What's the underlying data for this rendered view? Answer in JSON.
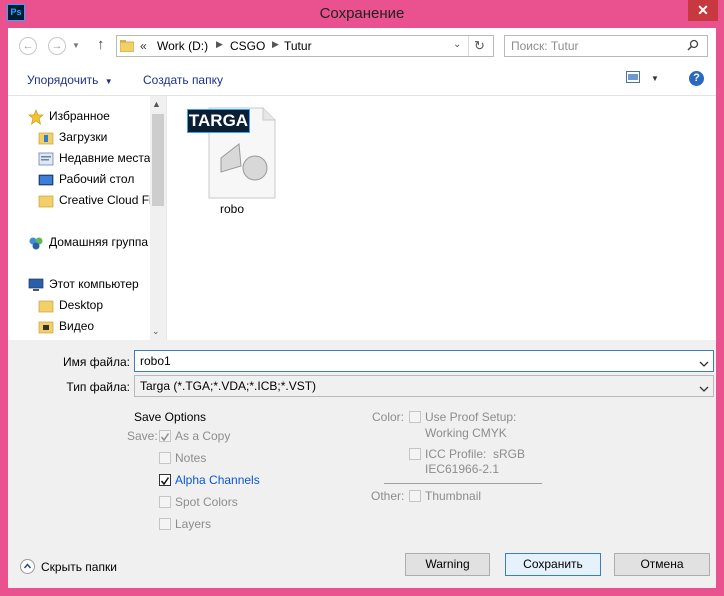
{
  "window": {
    "title": "Сохранение",
    "app_badge": "Ps"
  },
  "nav": {
    "path": [
      "«",
      "Work (D:)",
      "CSGO",
      "Tutur"
    ],
    "search_placeholder": "Поиск: Tutur"
  },
  "toolbar": {
    "organize_label": "Упорядочить",
    "new_folder_label": "Создать папку",
    "help": "?"
  },
  "sidebar": {
    "favorites": {
      "label": "Избранное",
      "items": [
        "Загрузки",
        "Недавние места",
        "Рабочий стол",
        "Creative Cloud Fi"
      ]
    },
    "homegroup": {
      "label": "Домашняя группа"
    },
    "computer": {
      "label": "Этот компьютер",
      "items": [
        "Desktop",
        "Видео"
      ]
    }
  },
  "file": {
    "name": "robo",
    "badge": "TARGA"
  },
  "form": {
    "filename_label": "Имя файла:",
    "filename_value": "robo1",
    "filetype_label": "Тип файла:",
    "filetype_value": "Targa (*.TGA;*.VDA;*.ICB;*.VST)"
  },
  "save_options": {
    "heading": "Save Options",
    "save_label": "Save:",
    "as_copy": {
      "label": "As a Copy",
      "checked": true,
      "enabled": false
    },
    "notes": {
      "label": "Notes",
      "checked": false,
      "enabled": false
    },
    "alpha": {
      "label": "Alpha Channels",
      "checked": true,
      "enabled": true
    },
    "spot": {
      "label": "Spot Colors",
      "checked": false,
      "enabled": false
    },
    "layers": {
      "label": "Layers",
      "checked": false,
      "enabled": false
    },
    "color_label": "Color:",
    "proof": {
      "line1": "Use Proof Setup:",
      "line2": "Working CMYK"
    },
    "icc": {
      "line1": "ICC Profile:  sRGB",
      "line2": "IEC61966-2.1"
    },
    "other_label": "Other:",
    "thumbnail": {
      "label": "Thumbnail",
      "checked": false,
      "enabled": false
    }
  },
  "footer": {
    "hide_folders_label": "Скрыть папки",
    "warning_button": "Warning",
    "save_button": "Сохранить",
    "cancel_button": "Отмена"
  },
  "colors": {
    "frame": "#e9528e",
    "accent": "#1e3287",
    "close": "#c7383f",
    "link_blue": "#0b57d0"
  }
}
